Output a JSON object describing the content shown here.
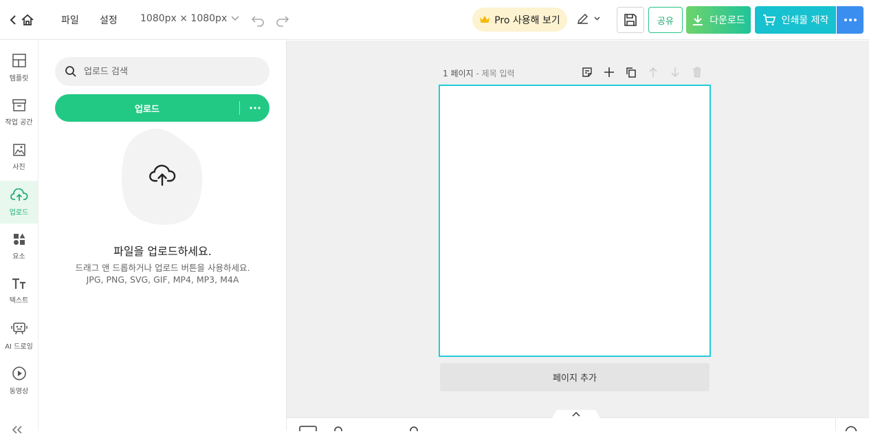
{
  "topbar": {
    "menu_file": "파일",
    "menu_settings": "설정",
    "canvas_size": "1080px × 1080px",
    "pro_label": "Pro 사용해 보기",
    "share_label": "공유",
    "download_label": "다운로드",
    "print_label": "인쇄물 제작"
  },
  "rail": {
    "items": [
      {
        "label": "템플릿",
        "icon": "layout-icon"
      },
      {
        "label": "작업 공간",
        "icon": "archive-icon"
      },
      {
        "label": "사진",
        "icon": "image-icon"
      },
      {
        "label": "업로드",
        "icon": "cloud-upload-icon",
        "active": true
      },
      {
        "label": "요소",
        "icon": "shapes-icon"
      },
      {
        "label": "텍스트",
        "icon": "text-icon"
      },
      {
        "label": "AI 드로잉",
        "icon": "robot-icon"
      },
      {
        "label": "동영상",
        "icon": "play-icon"
      }
    ]
  },
  "panel": {
    "search_placeholder": "업로드 검색",
    "upload_button": "업로드",
    "title": "파일을 업로드하세요.",
    "desc_line1": "드래그 앤 드롭하거나 업로드 버튼을 사용하세요.",
    "desc_line2": "JPG, PNG, SVG, GIF, MP4, MP3, M4A"
  },
  "canvas": {
    "page_number": "1 페이지",
    "page_title_placeholder": "- 제목 입력",
    "add_page": "페이지 추가"
  },
  "colors": {
    "accent_green": "#22c985",
    "artboard_border": "#22ccd8",
    "print_button": "#18c1cf",
    "more_button": "#3a8ef0",
    "pro_bg": "#fdf3d0"
  }
}
